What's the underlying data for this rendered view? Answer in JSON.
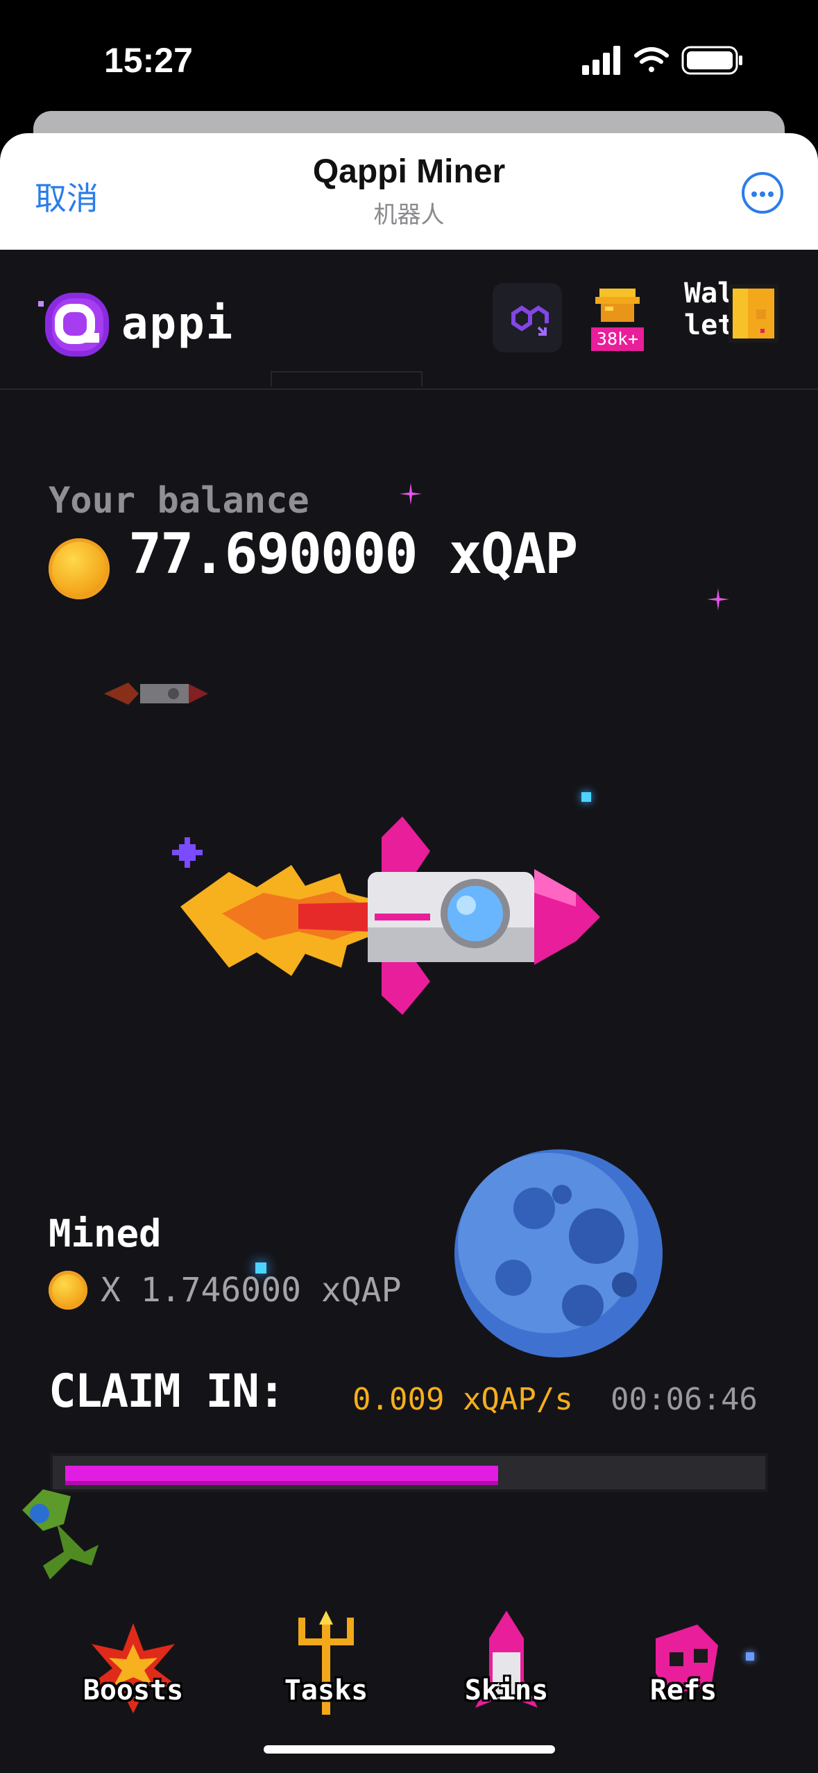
{
  "status_bar": {
    "time": "15:27"
  },
  "sheet_header": {
    "cancel_label": "取消",
    "title": "Qappi Miner",
    "subtitle": "机器人"
  },
  "app_header": {
    "logo_text": "appi",
    "coins_badge": "38k+",
    "wallet_text": "Wal let"
  },
  "balance": {
    "label": "Your balance",
    "value": "77.690000 xQAP"
  },
  "mined": {
    "label": "Mined",
    "value": "X 1.746000 xQAP"
  },
  "claim": {
    "label": "CLAIM IN:",
    "rate": "0.009 xQAP/s",
    "countdown": "00:06:46",
    "progress_fraction": 0.63
  },
  "bottom_nav": [
    {
      "label": "Boosts",
      "icon": "explosion-icon"
    },
    {
      "label": "Tasks",
      "icon": "trident-icon"
    },
    {
      "label": "Skins",
      "icon": "rocket-icon"
    },
    {
      "label": "Refs",
      "icon": "alien-icon"
    }
  ],
  "colors": {
    "accent_blue": "#2b7de9",
    "magenta": "#e11de1",
    "gold": "#f7ae1e",
    "background": "#141418"
  }
}
